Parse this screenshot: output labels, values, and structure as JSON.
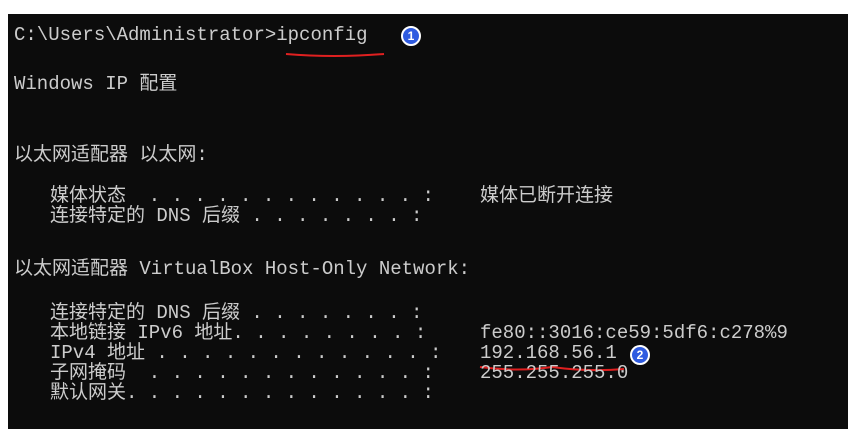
{
  "prompt": "C:\\Users\\Administrator>",
  "command": "ipconfig",
  "header": "Windows IP 配置",
  "adapter1": {
    "title": "以太网适配器 以太网:",
    "rows": [
      {
        "label": "媒体状态  . . . . . . . . . . . . :",
        "value": "媒体已断开连接"
      },
      {
        "label": "连接特定的 DNS 后缀 . . . . . . . :",
        "value": ""
      }
    ]
  },
  "adapter2": {
    "title": "以太网适配器 VirtualBox Host-Only Network:",
    "rows": [
      {
        "label": "连接特定的 DNS 后缀 . . . . . . . :",
        "value": ""
      },
      {
        "label": "本地链接 IPv6 地址. . . . . . . . :",
        "value": "fe80::3016:ce59:5df6:c278%9"
      },
      {
        "label": "IPv4 地址 . . . . . . . . . . . . :",
        "value": "192.168.56.1"
      },
      {
        "label": "子网掩码  . . . . . . . . . . . . :",
        "value": "255.255.255.0"
      },
      {
        "label": "默认网关. . . . . . . . . . . . . :",
        "value": ""
      }
    ]
  },
  "annotations": {
    "marker1": "1",
    "marker2": "2",
    "marker_color": "#2f5be0",
    "underline_color": "#e02020"
  }
}
